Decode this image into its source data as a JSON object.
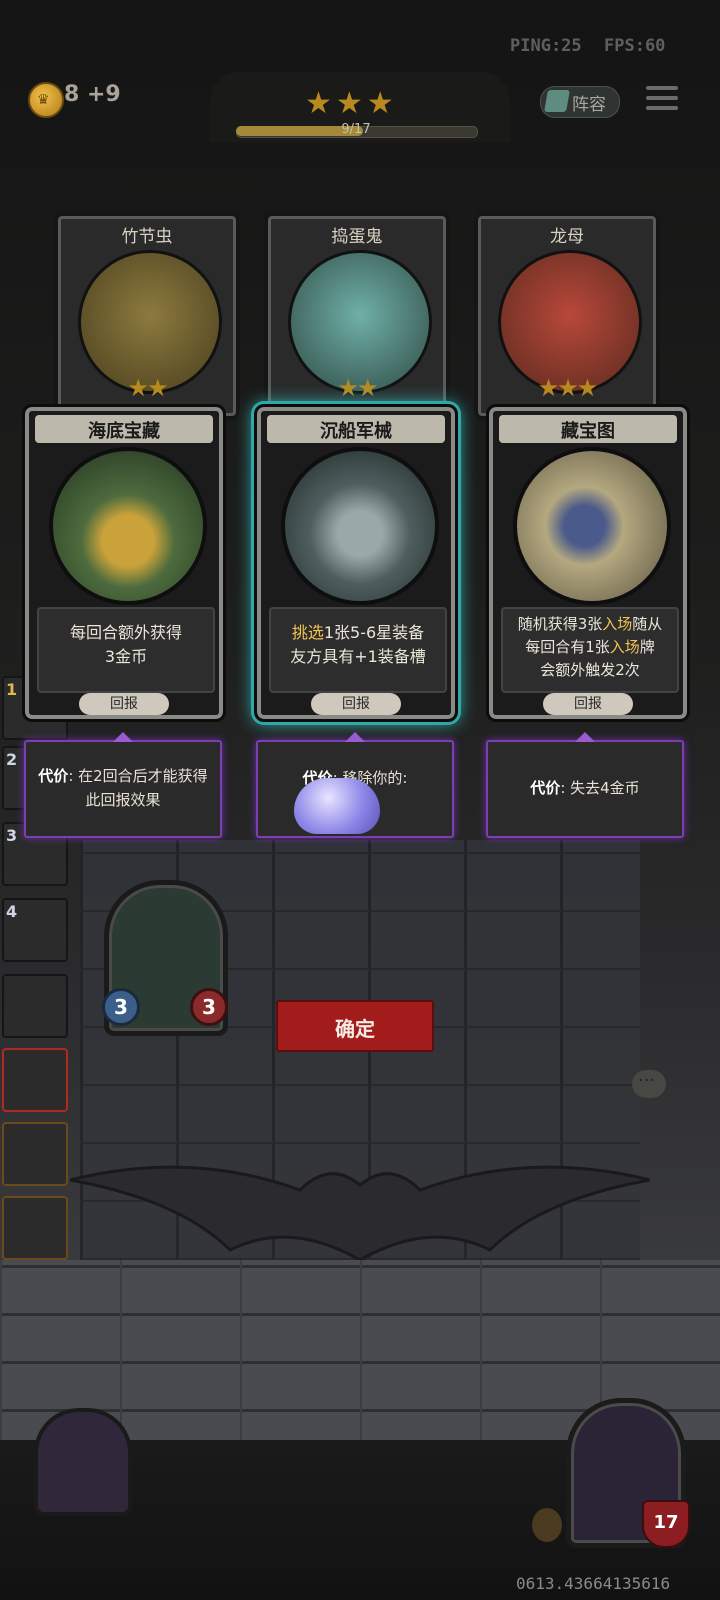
{
  "hud": {
    "ping": "PING:25",
    "fps": "FPS:60",
    "gold": "8 +9",
    "stars": "★★★",
    "progress_text": "9/17",
    "progress_fraction": 0.53,
    "lineup_label": "阵容",
    "coin_icon": "crown-coin-icon",
    "menu_icon": "hamburger-menu-icon"
  },
  "heroes": [
    {
      "name": "竹节虫",
      "stars": "★★",
      "art_color": "#6b5a2a"
    },
    {
      "name": "捣蛋鬼",
      "stars": "★★",
      "art_color": "#4f6a60"
    },
    {
      "name": "龙母",
      "stars": "★★★",
      "art_color": "#8a3a2a"
    }
  ],
  "cards": [
    {
      "title": "海底宝藏",
      "desc_lines": [
        "每回合额外获得",
        "3金币"
      ],
      "reward": "回报",
      "art_color": "#4d6b3e",
      "selected": false,
      "cost_label": "代价",
      "cost_text": ": 在2回合后才能获得此回报效果"
    },
    {
      "title": "沉船军械",
      "desc_highlight": "挑选",
      "desc_line1_rest": "1张5-6星装备",
      "desc_line2": "友方具有+1装备槽",
      "reward": "回报",
      "art_color": "#5a6a6a",
      "selected": true,
      "cost_label": "代价",
      "cost_text": ": 移除你的:"
    },
    {
      "title": "藏宝图",
      "desc_l1a": "随机获得3张",
      "desc_l1h": "入场",
      "desc_l1b": "随从",
      "desc_l2a": "每回合有1张",
      "desc_l2h": "入场",
      "desc_l2b": "牌",
      "desc_l3": "会额外触发2次",
      "reward": "回报",
      "art_color": "#8c8466",
      "selected": false,
      "cost_label": "代价",
      "cost_text": ": 失去4金币"
    }
  ],
  "queue": [
    "1",
    "2",
    "3",
    "4"
  ],
  "confirm_label": "确定",
  "center_hero": {
    "attack": "3",
    "health": "3"
  },
  "player": {
    "hp": "17"
  },
  "footer_id": "0613.43664135616",
  "colors": {
    "accent_gold": "#f1c453",
    "confirm_red": "#a31c1c",
    "cost_purple": "#7b3fb0",
    "select_cyan": "#39c9c9"
  }
}
